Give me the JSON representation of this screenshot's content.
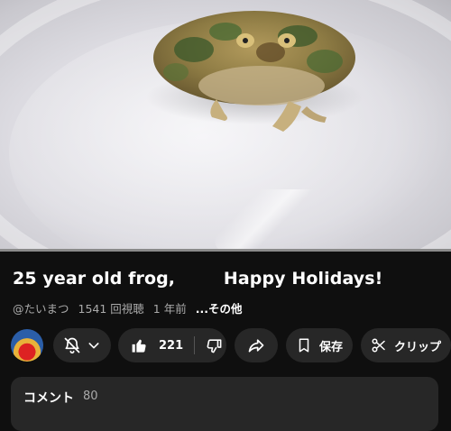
{
  "video": {
    "progress_fraction": 0
  },
  "title": "25 year old frog,        Happy Holidays!",
  "meta": {
    "channel": "@たいまつ",
    "views": "1541 回視聴",
    "age": "1 年前",
    "more": "...その他"
  },
  "actions": {
    "bell_icon": "bell-off-icon",
    "likes": "221",
    "save": "保存",
    "clip": "クリップ"
  },
  "comments": {
    "label": "コメント",
    "count": "80"
  },
  "colors": {
    "background": "#0f0f0f",
    "pill": "#272727",
    "muted_text": "#aaaaaa",
    "progress": "#ff0000"
  }
}
